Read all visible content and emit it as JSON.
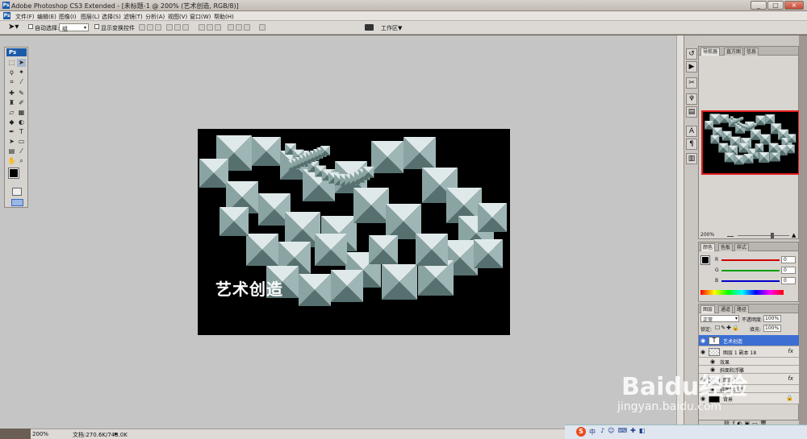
{
  "app": {
    "title": "Adobe Photoshop CS3 Extended - [未标题-1 @ 200% (艺术创造, RGB/8)]",
    "logo_text": "Ps",
    "window_buttons": [
      "_",
      "□",
      "×"
    ]
  },
  "menu": [
    "文件(F)",
    "编辑(E)",
    "图像(I)",
    "图层(L)",
    "选择(S)",
    "滤镜(T)",
    "分析(A)",
    "视图(V)",
    "窗口(W)",
    "帮助(H)"
  ],
  "options_bar": {
    "auto_select_label": "自动选择:",
    "auto_select_value": "组",
    "show_transform_label": "显示变换控件",
    "workspace_label": "工作区▼"
  },
  "canvas": {
    "text": "艺术创造",
    "background_color": "#000000",
    "pattern_color": "#9fb6b6"
  },
  "status": {
    "zoom": "200%",
    "doc_info": "文档:270.6K/743.0K"
  },
  "navigator": {
    "tabs": [
      "导航器",
      "直方图",
      "信息"
    ],
    "zoom": "200%"
  },
  "color_panel": {
    "tabs": [
      "颜色",
      "色板",
      "样式"
    ],
    "channels": [
      {
        "label": "R",
        "value": "0",
        "color": "#d00000"
      },
      {
        "label": "G",
        "value": "0",
        "color": "#00a000"
      },
      {
        "label": "B",
        "value": "0",
        "color": "#0000c8"
      }
    ]
  },
  "layers_panel": {
    "tabs": [
      "图层",
      "通道",
      "路径"
    ],
    "blend_mode": "正常",
    "opacity_label": "不透明度:",
    "opacity_value": "100%",
    "lock_label": "锁定:",
    "fill_label": "填充:",
    "fill_value": "100%",
    "layers": [
      {
        "name": "艺术创造",
        "type": "text",
        "selected": true
      },
      {
        "name": "图层 1 副本 18",
        "type": "pattern",
        "fx": "fx"
      },
      {
        "name": "效果",
        "type": "sub"
      },
      {
        "name": "斜面和浮雕",
        "type": "sub"
      },
      {
        "name": "图层 1",
        "type": "pattern",
        "fx": "fx"
      },
      {
        "name": "斜面和浮雕",
        "type": "sub"
      },
      {
        "name": "背景",
        "type": "background"
      }
    ]
  },
  "watermark": {
    "brand": "Baidu经验",
    "url": "jingyan.baidu.com"
  },
  "taskbar": {
    "ime": "中"
  }
}
